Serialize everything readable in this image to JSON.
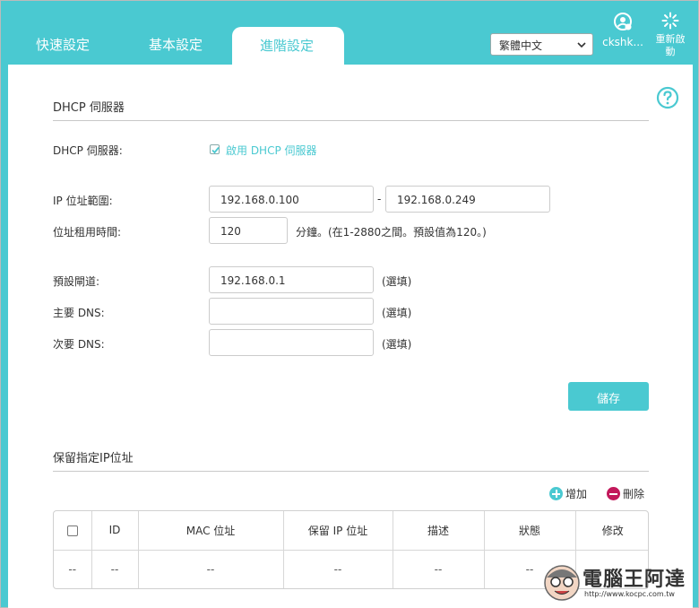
{
  "nav": {
    "tabs": [
      "快速設定",
      "基本設定",
      "進階設定"
    ],
    "active_tab": "進階設定",
    "language": "繁體中文",
    "user_label": "ckshk...",
    "reboot_label": "重新啟動"
  },
  "dhcp": {
    "section_title": "DHCP 伺服器",
    "server_label": "DHCP 伺服器:",
    "enable_label": "啟用 DHCP 伺服器",
    "enable_checked": true,
    "ip_range_label": "IP 位址範圍:",
    "ip_start": "192.168.0.100",
    "range_sep": "-",
    "ip_end": "192.168.0.249",
    "lease_label": "位址租用時間:",
    "lease_value": "120",
    "lease_note": "分鐘。(在1-2880之間。預設值為120。)",
    "gateway_label": "預設閘道:",
    "gateway_value": "192.168.0.1",
    "optional_note": "(選填)",
    "primary_dns_label": "主要 DNS:",
    "primary_dns_value": "",
    "secondary_dns_label": "次要 DNS:",
    "secondary_dns_value": "",
    "save_label": "儲存"
  },
  "reserved": {
    "section_title": "保留指定IP位址",
    "add_label": "增加",
    "delete_label": "刪除",
    "columns": [
      "ID",
      "MAC 位址",
      "保留 IP 位址",
      "描述",
      "狀態",
      "修改"
    ],
    "row": [
      "--",
      "--",
      "--",
      "--",
      "--",
      "--",
      "--"
    ]
  },
  "watermark": {
    "title": "電腦王阿達",
    "url": "http://www.kocpc.com.tw"
  },
  "colors": {
    "accent": "#4ac9d1",
    "delete": "#c2185b"
  }
}
